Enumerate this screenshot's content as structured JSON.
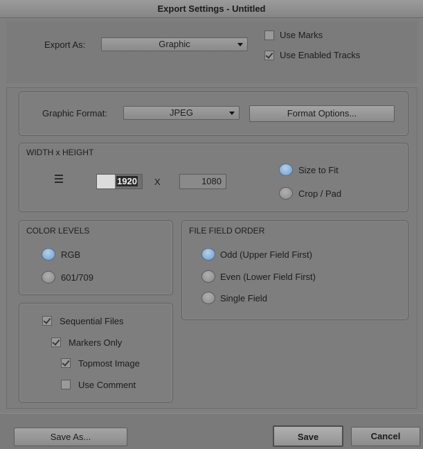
{
  "window": {
    "title": "Export Settings - Untitled"
  },
  "top": {
    "export_as_label": "Export As:",
    "export_as_value": "Graphic",
    "use_marks": {
      "label": "Use Marks",
      "checked": false
    },
    "use_enabled_tracks": {
      "label": "Use Enabled Tracks",
      "checked": true
    }
  },
  "graphic": {
    "format_label": "Graphic Format:",
    "format_value": "JPEG",
    "format_options_label": "Format Options..."
  },
  "size": {
    "title": "WIDTH x HEIGHT",
    "width": "1920",
    "separator": "X",
    "height": "1080",
    "size_to_fit": "Size to Fit",
    "crop_pad": "Crop / Pad",
    "selected": "Size to Fit"
  },
  "color_levels": {
    "title": "COLOR LEVELS",
    "options": [
      "RGB",
      "601/709"
    ],
    "selected": "RGB"
  },
  "field_order": {
    "title": "FILE FIELD ORDER",
    "options": [
      "Odd (Upper Field First)",
      "Even (Lower Field First)",
      "Single Field"
    ],
    "selected": "Odd (Upper Field First)"
  },
  "sequence": {
    "sequential_files": {
      "label": "Sequential Files",
      "checked": true
    },
    "markers_only": {
      "label": "Markers Only",
      "checked": true
    },
    "topmost_image": {
      "label": "Topmost Image",
      "checked": true
    },
    "use_comment": {
      "label": "Use Comment",
      "checked": false
    }
  },
  "footer": {
    "save_as": "Save As...",
    "save": "Save",
    "cancel": "Cancel"
  },
  "colors": {
    "background": "#7f7f7f",
    "radio_selected": "#6f9bc8"
  }
}
